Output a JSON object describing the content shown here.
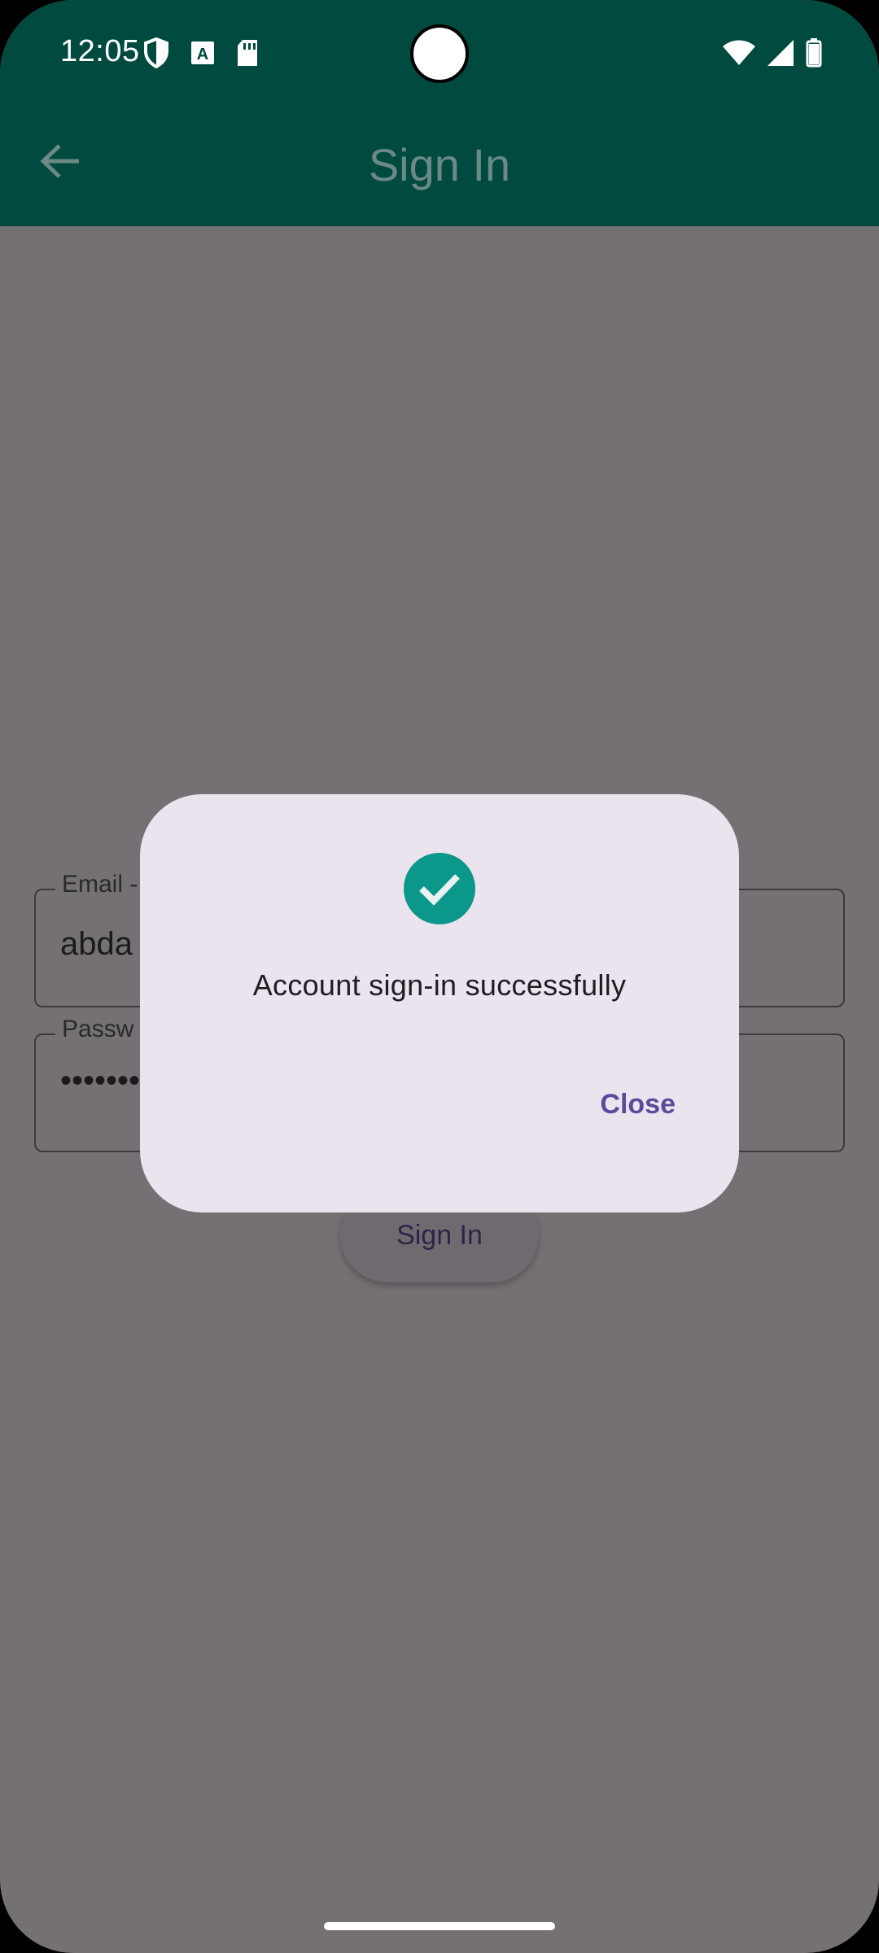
{
  "status_bar": {
    "time": "12:05",
    "left_icons": [
      "shield-icon",
      "a-box-icon",
      "sd-card-icon"
    ],
    "right_icons": [
      "wifi-icon",
      "signal-icon",
      "battery-icon"
    ]
  },
  "app_bar": {
    "title": "Sign In",
    "back_icon": "arrow-back-icon"
  },
  "form": {
    "email_label": "Email -",
    "email_value": "abda",
    "password_label": "Passw",
    "password_value": "•••••••",
    "signin_button": "Sign In"
  },
  "dialog": {
    "icon": "check-circle-icon",
    "message": "Account sign-in successfully",
    "close_label": "Close"
  },
  "colors": {
    "app_bar": "#004a40",
    "scrim": "#757074",
    "dialog_bg": "#ebe4ef",
    "success": "#0b978a",
    "accent": "#5b4a9a"
  }
}
